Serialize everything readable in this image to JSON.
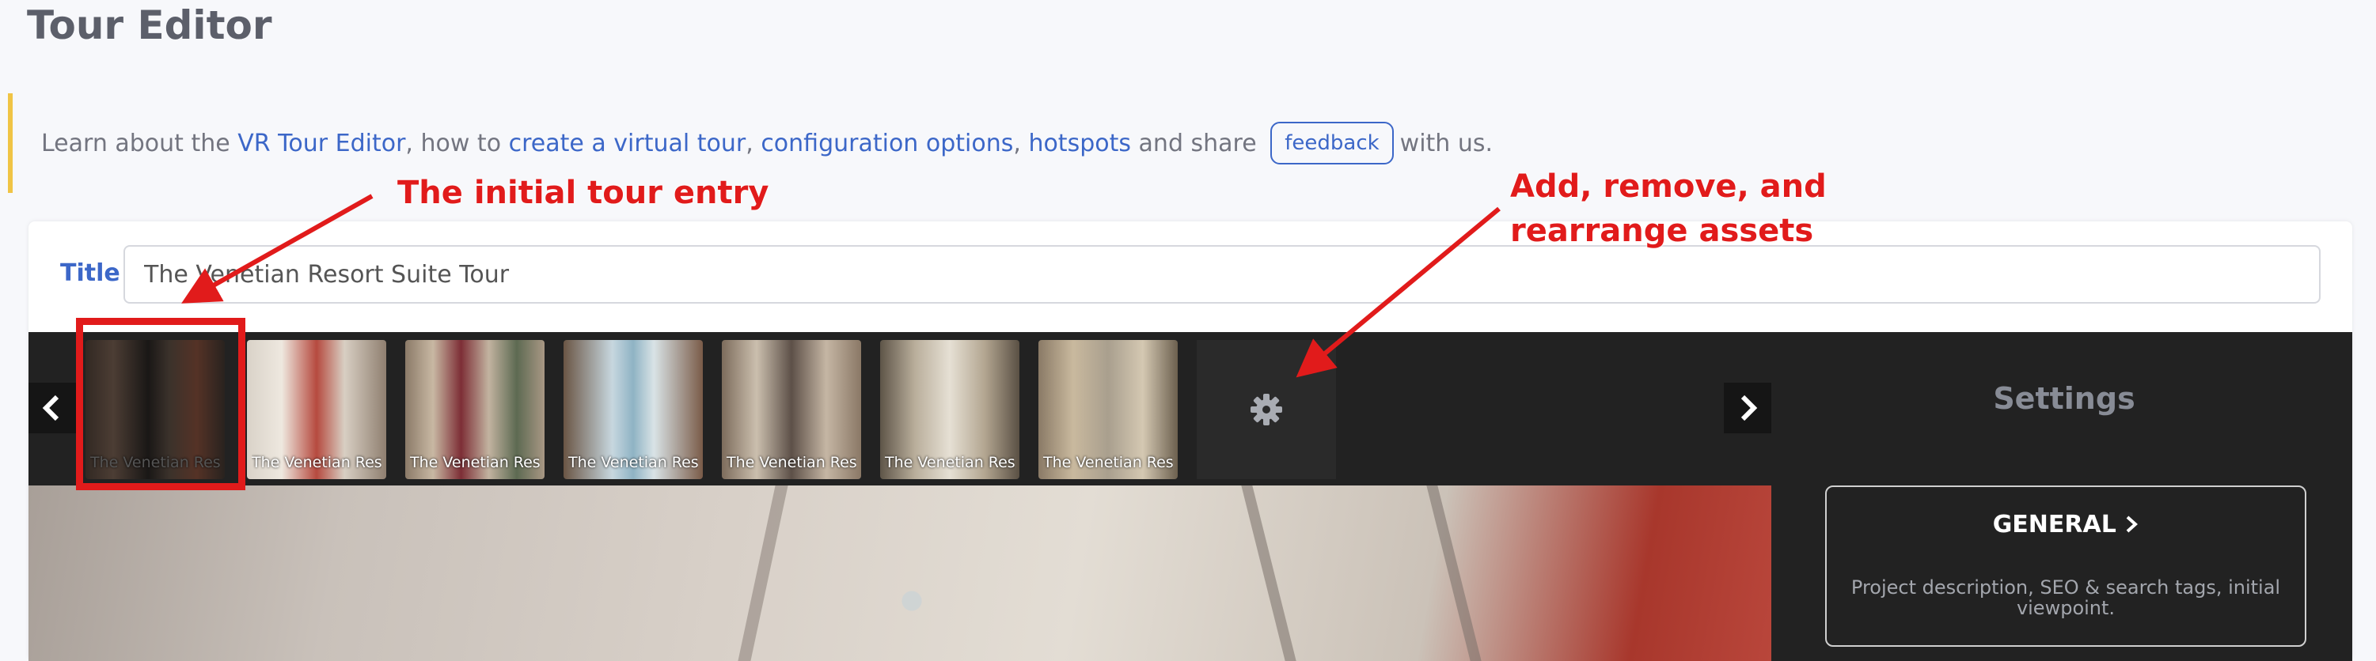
{
  "page": {
    "title": "Tour Editor"
  },
  "notice": {
    "prefix": "Learn about the ",
    "link_editor": "VR Tour Editor",
    "mid1": ", how to ",
    "link_create": "create a virtual tour",
    "comma": ",",
    "link_config": "configuration options",
    "comma2": ",",
    "link_hotspots": "hotspots",
    "mid2": " and share ",
    "feedback": "feedback",
    "suffix": " with us."
  },
  "form": {
    "title_label": "Title",
    "title_value": "The Venetian Resort Suite Tour"
  },
  "thumbnails": [
    {
      "caption": "The Venetian Res..."
    },
    {
      "caption": "The Venetian Res..."
    },
    {
      "caption": "The Venetian Res..."
    },
    {
      "caption": "The Venetian Res..."
    },
    {
      "caption": "The Venetian Res..."
    },
    {
      "caption": "The Venetian Res..."
    },
    {
      "caption": "The Venetian Res..."
    }
  ],
  "settings": {
    "title": "Settings",
    "general_label": "GENERAL",
    "general_description": "Project description, SEO & search tags, initial viewpoint."
  },
  "annotations": {
    "initial_entry": "The initial tour entry",
    "assets_line1": "Add, remove, and",
    "assets_line2": "rearrange assets"
  },
  "icons": {
    "prev": "chevron-left-icon",
    "next": "chevron-right-icon",
    "settings": "gear-icon",
    "general": "chevron-right-icon"
  },
  "colors": {
    "accent": "#3c67c8",
    "annotation": "#e11b1b",
    "notice_bar": "#f0c445",
    "editor_bg": "#1f1f1f"
  }
}
